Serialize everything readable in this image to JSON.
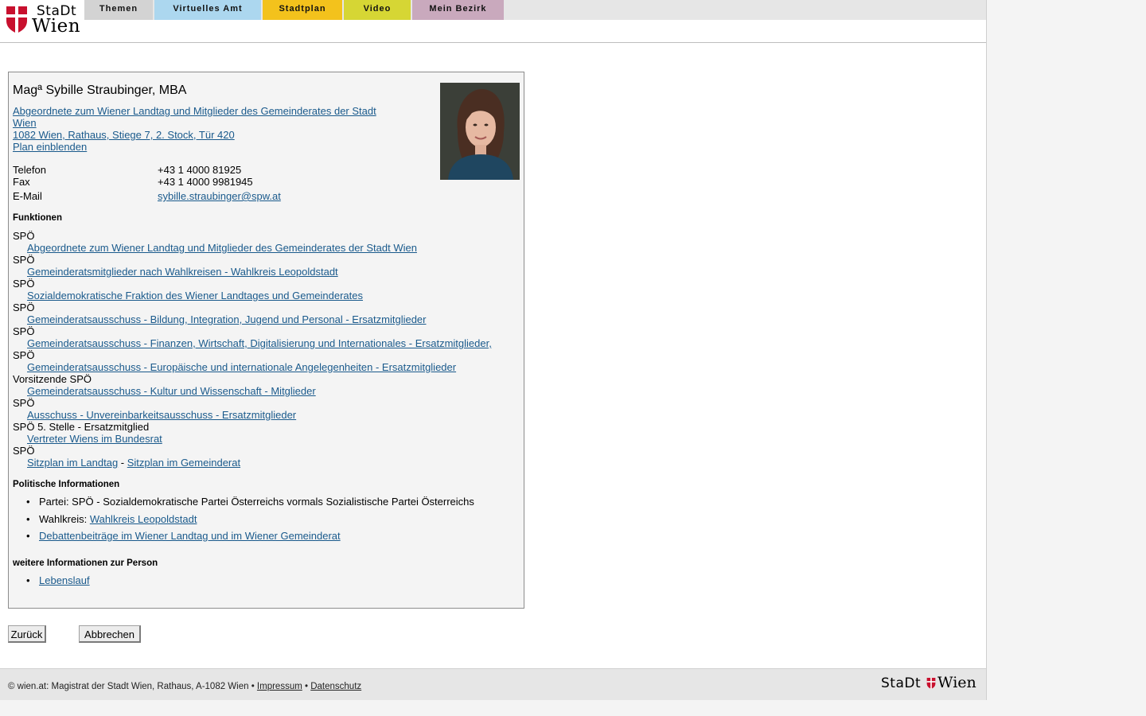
{
  "header": {
    "logo_top": "StaDt",
    "logo_bottom": "Wien",
    "tabs": [
      "Themen",
      "Virtuelles Amt",
      "Stadtplan",
      "Video",
      "Mein Bezirk"
    ]
  },
  "person": {
    "name": "Magª Sybille Straubinger, MBA",
    "role_line1": "Abgeordnete zum Wiener Landtag und Mitglieder des Gemeinderates der Stadt",
    "role_line2": "Wien",
    "address": "1082 Wien, Rathaus, Stiege 7, 2. Stock, Tür 420",
    "map_link": "Plan einblenden",
    "contacts": [
      {
        "label": "Telefon",
        "value": "+43 1 4000 81925"
      },
      {
        "label": "Fax",
        "value": "+43 1 4000 9981945"
      },
      {
        "label": "E-Mail",
        "value": "sybille.straubinger@spw.at"
      }
    ]
  },
  "functions": {
    "heading": "Funktionen",
    "items": [
      {
        "party": "SPÖ",
        "link": "Abgeordnete zum Wiener Landtag und Mitglieder des Gemeinderates der Stadt Wien"
      },
      {
        "party": "SPÖ",
        "link": "Gemeinderatsmitglieder nach Wahlkreisen - Wahlkreis Leopoldstadt"
      },
      {
        "party": "SPÖ",
        "link": "Sozialdemokratische Fraktion des Wiener Landtages und Gemeinderates"
      },
      {
        "party": "SPÖ",
        "link": "Gemeinderatsausschuss - Bildung, Integration, Jugend und Personal - Ersatzmitglieder"
      },
      {
        "party": "SPÖ",
        "link": "Gemeinderatsausschuss - Finanzen, Wirtschaft, Digitalisierung und Internationales - Ersatzmitglieder,"
      },
      {
        "party": "SPÖ",
        "link": "Gemeinderatsausschuss - Europäische und internationale Angelegenheiten - Ersatzmitglieder"
      },
      {
        "party": "Vorsitzende SPÖ",
        "link": "Gemeinderatsausschuss - Kultur und Wissenschaft - Mitglieder"
      },
      {
        "party": "SPÖ",
        "link": "Ausschuss - Unvereinbarkeitsausschuss - Ersatzmitglieder"
      },
      {
        "party": "SPÖ 5. Stelle - Ersatzmitglied",
        "link": "Vertreter Wiens im Bundesrat"
      }
    ],
    "last_party": "SPÖ",
    "seat_landtag": "Sitzplan im Landtag",
    "seat_sep": " - ",
    "seat_gemeinderat": "Sitzplan im Gemeinderat"
  },
  "political": {
    "heading": "Politische Informationen",
    "party_text": "Partei: SPÖ - Sozialdemokratische Partei Österreichs vormals Sozialistische Partei Österreichs",
    "district_label": "Wahlkreis: ",
    "district_link": "Wahlkreis Leopoldstadt",
    "debates_link": "Debattenbeiträge im Wiener Landtag und im Wiener Gemeinderat"
  },
  "more": {
    "heading": "weitere Informationen zur Person",
    "cv_link": "Lebenslauf"
  },
  "buttons": {
    "back": "Zurück",
    "cancel": "Abbrechen"
  },
  "footer": {
    "text": "© wien.at: Magistrat der Stadt Wien, Rathaus, A-1082 Wien • ",
    "imprint": "Impressum",
    "sep": " • ",
    "privacy": "Datenschutz",
    "logo_text_left": "StaDt",
    "logo_text_right": "Wien"
  },
  "colors": {
    "link": "#1a5a8c",
    "brand_red": "#c8102e"
  }
}
